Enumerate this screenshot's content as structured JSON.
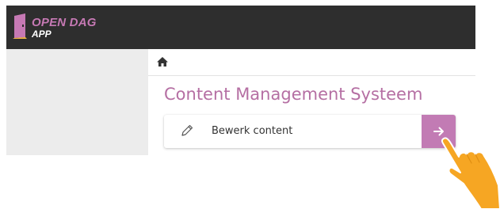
{
  "header": {
    "logo_line1": "OPEN DAG",
    "logo_line2": "APP",
    "brand_color": "#c27bb4",
    "bar_color": "#2e2e2e"
  },
  "breadcrumb": {
    "home_icon": "home-icon"
  },
  "main": {
    "title": "Content Management Systeem",
    "actions": [
      {
        "label": "Bewerk content",
        "icon": "pencil-icon",
        "button_icon": "arrow-right-icon"
      }
    ]
  },
  "overlay": {
    "pointer_icon": "pointing-hand-icon",
    "pointer_color": "#f6a623"
  }
}
